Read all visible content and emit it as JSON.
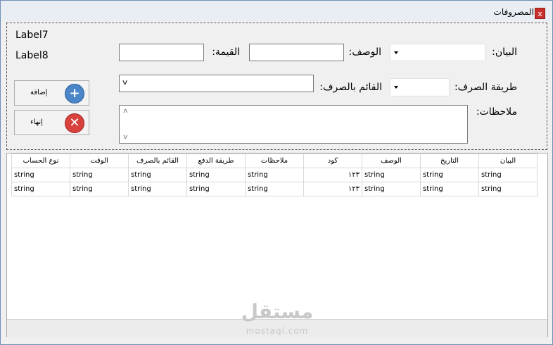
{
  "window": {
    "title": "المصروفات",
    "close_label": "x"
  },
  "labels": {
    "label7": "Label7",
    "label8": "Label8"
  },
  "form": {
    "statement_label": "البيان:",
    "description_label": "الوصف:",
    "value_label": "القيمة:",
    "payment_method_label": "طريقة الصرف:",
    "spender_label": "القائم بالصرف:",
    "notes_label": "ملاحظات:"
  },
  "buttons": {
    "add_label": "إضافة",
    "end_label": "إنهاء"
  },
  "grid": {
    "columns": [
      "البيان",
      "التاريخ",
      "الوصف",
      "كود",
      "ملاحظات",
      "طريقة الدفع",
      "القائم بالصرف",
      "الوقت",
      "نوع الحساب"
    ],
    "rows": [
      [
        "string",
        "string",
        "string",
        "١٢٣",
        "string",
        "string",
        "string",
        "string",
        "string"
      ],
      [
        "string",
        "string",
        "string",
        "١٢٣",
        "string",
        "string",
        "string",
        "string",
        "string"
      ]
    ]
  },
  "watermark": {
    "arabic": "مستقل",
    "latin": "mostaql.com"
  }
}
